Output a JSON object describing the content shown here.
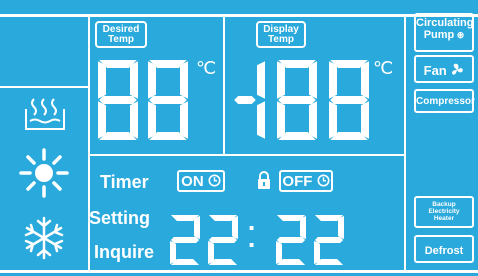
{
  "desired_temp": {
    "label_line1": "Desired",
    "label_line2": "Temp",
    "digits": "88",
    "unit": "℃"
  },
  "display_temp": {
    "label_line1": "Display",
    "label_line2": "Temp",
    "digits": "-188",
    "unit": "℃"
  },
  "indicators": {
    "circulating_pump": {
      "line1": "Circulating",
      "line2": "Pump"
    },
    "fan": "Fan",
    "compressor": "Compressor",
    "backup_heater": {
      "line1": "Backup",
      "line2": "Electricity",
      "line3": "Heater"
    },
    "defrost": "Defrost"
  },
  "timer": {
    "label": "Timer",
    "on": "ON",
    "off": "OFF"
  },
  "setting_label": "Setting",
  "inquire_label": "Inquire",
  "clock": {
    "hours": "22",
    "separator": ":",
    "minutes": "22"
  },
  "modes": [
    "water-heating-icon",
    "sun-icon",
    "snowflake-icon"
  ],
  "colors": {
    "background": "#2aa9dc",
    "segment": "#ffffff"
  }
}
